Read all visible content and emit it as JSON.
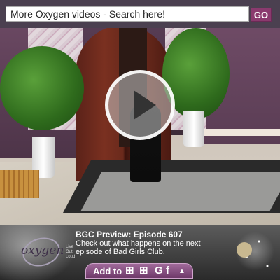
{
  "search": {
    "text": "More Oxygen videos - Search here!",
    "go_label": "GO"
  },
  "promo": {
    "title": "BGC Preview: Episode 607",
    "description": "Check out what happens on the next episode of Bad Girls Club.",
    "logo_text": "oxygen",
    "logo_tagline": "Live Out Loud"
  },
  "addto": {
    "label": "Add to",
    "icons": {
      "windows": "⊞",
      "google": "G",
      "facebook": "f",
      "more": "▲"
    }
  },
  "colors": {
    "accent": "#8a3a6e",
    "searchbar_bg": "#4b4050"
  }
}
